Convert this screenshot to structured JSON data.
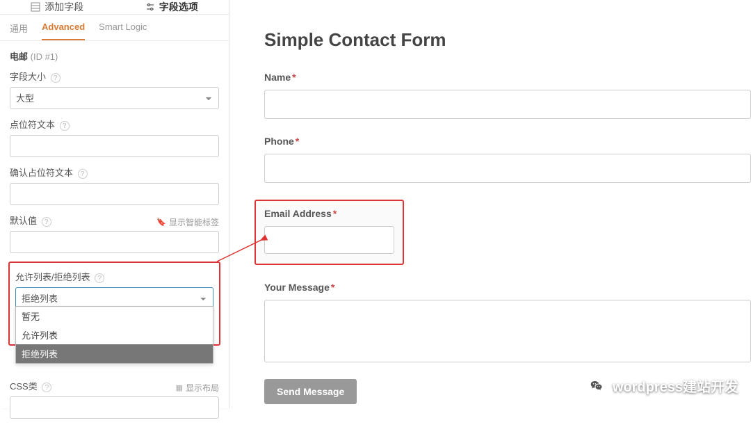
{
  "topTabs": {
    "add": "添加字段",
    "options": "字段选项"
  },
  "subTabs": {
    "general": "通用",
    "advanced": "Advanced",
    "smartLogic": "Smart Logic"
  },
  "section": {
    "title": "电邮",
    "idSuffix": "(ID #1)"
  },
  "fields": {
    "sizeLabel": "字段大小",
    "sizeValue": "大型",
    "placeholderLabel": "点位符文本",
    "confirmPlaceholderLabel": "确认占位符文本",
    "defaultLabel": "默认值",
    "defaultHint": "显示智能标签",
    "allowDenyLabel": "允许列表/拒绝列表",
    "allowDenyValue": "拒绝列表",
    "options": {
      "none": "暂无",
      "allow": "允许列表",
      "deny": "拒绝列表"
    },
    "cssLabel": "CSS类",
    "cssHint": "显示布局"
  },
  "form": {
    "title": "Simple Contact Form",
    "nameLabel": "Name",
    "phoneLabel": "Phone",
    "emailLabel": "Email Address",
    "messageLabel": "Your Message",
    "submit": "Send Message"
  },
  "watermark": "wordpress建站开发"
}
